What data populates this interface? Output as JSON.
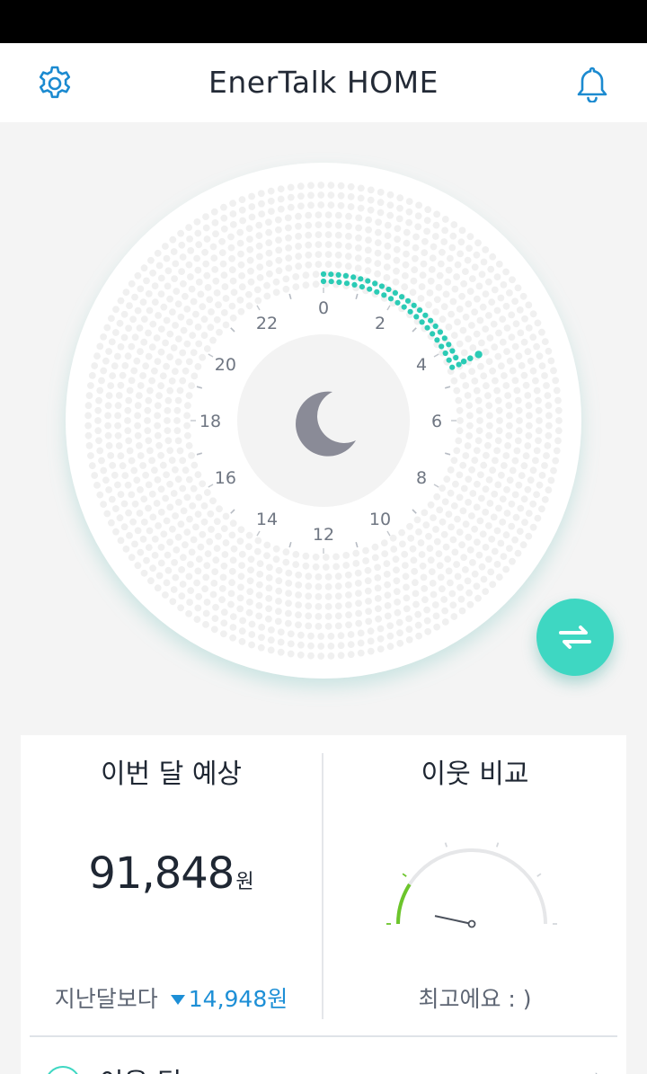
{
  "header": {
    "title": "EnerTalk HOME",
    "settings_icon": "gear-icon",
    "notification_icon": "bell-icon"
  },
  "dial": {
    "hour_labels": [
      "0",
      "2",
      "4",
      "6",
      "8",
      "10",
      "12",
      "14",
      "16",
      "18",
      "20",
      "22"
    ],
    "center_icon": "moon-icon",
    "accent_color": "#2bcbb5",
    "usage_arc_hours": [
      0,
      4.5
    ]
  },
  "fab": {
    "icon": "swap-arrows-icon",
    "color": "#3ed7c2"
  },
  "forecast": {
    "title": "이번 달 예상",
    "amount": "91,848",
    "unit": "원",
    "compare_label": "지난달보다",
    "compare_delta": "14,948원",
    "compare_direction": "down"
  },
  "neighbor": {
    "title": "이웃 비교",
    "message": "최고에요 : )",
    "gauge_fraction": 0.1
  },
  "next_section": {
    "label": "이용 팁",
    "icon": "tip-icon"
  },
  "colors": {
    "accent": "#3ed7c2",
    "link_blue": "#1d8fd6",
    "gauge_green": "#6cc52b"
  }
}
